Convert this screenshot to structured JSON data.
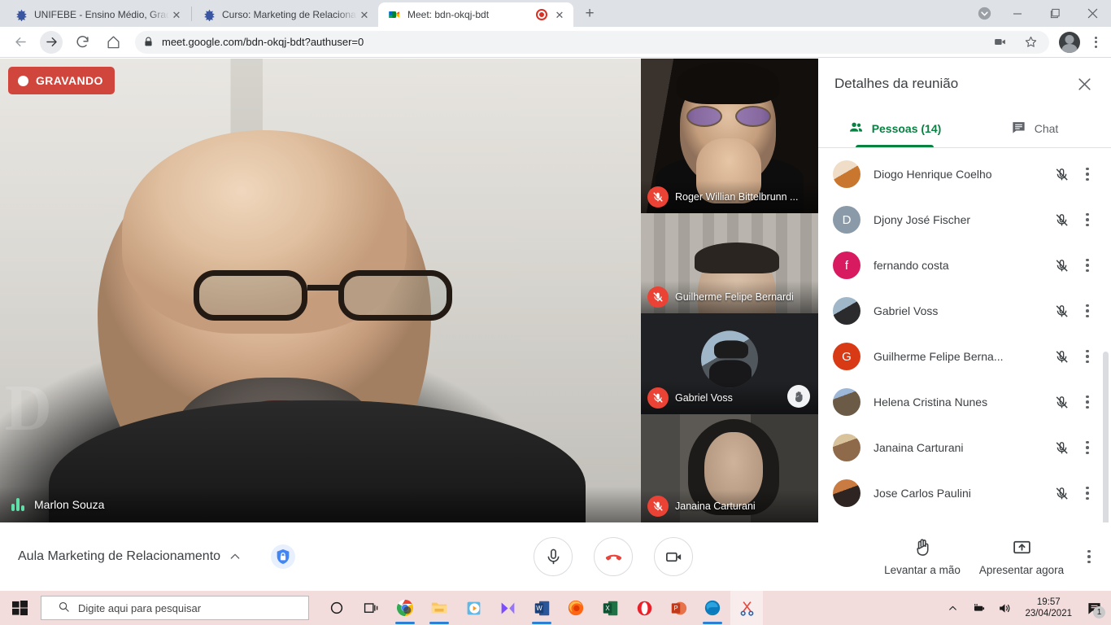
{
  "browser": {
    "tabs": [
      {
        "title": "UNIFEBE - Ensino Médio, Gradua",
        "favicon": "unifebe-icon",
        "active": false,
        "recording": false
      },
      {
        "title": "Curso: Marketing de Relacioname",
        "favicon": "unifebe-icon",
        "active": false,
        "recording": false
      },
      {
        "title": "Meet: bdn-okqj-bdt",
        "favicon": "google-meet-icon",
        "active": true,
        "recording": true
      }
    ],
    "new_tab_label": "+",
    "close_label": "✕",
    "url": "meet.google.com/bdn-okqj-bdt?authuser=0",
    "window_controls": {
      "minimize": "—",
      "maximize": "❐",
      "close": "✕"
    }
  },
  "meet": {
    "recording_badge": "GRAVANDO",
    "main_speaker": "Marlon Souza",
    "thumbnails": [
      {
        "name": "Roger Willian Bittelbrunn ...",
        "muted": true,
        "hand_raised": false
      },
      {
        "name": "Guilherme Felipe Bernardi",
        "muted": true,
        "hand_raised": false
      },
      {
        "name": "Gabriel Voss",
        "muted": true,
        "hand_raised": true
      },
      {
        "name": "Janaina Carturani",
        "muted": true,
        "hand_raised": false
      }
    ],
    "details": {
      "title": "Detalhes da reunião",
      "tabs": [
        {
          "label": "Pessoas (14)",
          "icon": "people-icon",
          "active": true
        },
        {
          "label": "Chat",
          "icon": "chat-icon",
          "active": false
        }
      ],
      "participants": [
        {
          "name": "Diogo Henrique Coelho",
          "avatar_type": "photo",
          "avatar_color": "#e8a87c",
          "initial": "",
          "muted": true
        },
        {
          "name": "Djony José Fischer",
          "avatar_type": "initial",
          "avatar_color": "#8a9aa8",
          "initial": "D",
          "muted": true
        },
        {
          "name": "fernando costa",
          "avatar_type": "initial",
          "avatar_color": "#d81b60",
          "initial": "f",
          "muted": true
        },
        {
          "name": "Gabriel Voss",
          "avatar_type": "photo",
          "avatar_color": "#6d7b86",
          "initial": "",
          "muted": true
        },
        {
          "name": "Guilherme Felipe Berna...",
          "avatar_type": "initial",
          "avatar_color": "#d93a16",
          "initial": "G",
          "muted": true
        },
        {
          "name": "Helena Cristina Nunes",
          "avatar_type": "photo",
          "avatar_color": "#8d7b63",
          "initial": "",
          "muted": true
        },
        {
          "name": "Janaina Carturani",
          "avatar_type": "photo",
          "avatar_color": "#b08d6a",
          "initial": "",
          "muted": true
        },
        {
          "name": "Jose Carlos Paulini",
          "avatar_type": "photo",
          "avatar_color": "#a85c3c",
          "initial": "",
          "muted": true
        }
      ]
    },
    "bottom_bar": {
      "meeting_title": "Aula Marketing de Relacionamento",
      "controls": [
        {
          "name": "microphone",
          "icon": "mic-icon"
        },
        {
          "name": "hangup",
          "icon": "phone-hangup-icon"
        },
        {
          "name": "camera",
          "icon": "video-icon"
        }
      ],
      "raise_hand_label": "Levantar a mão",
      "present_label": "Apresentar agora"
    }
  },
  "taskbar": {
    "search_placeholder": "Digite aqui para pesquisar",
    "apps": [
      "cortana-icon",
      "task-view-icon",
      "chrome-icon",
      "file-explorer-icon",
      "media-player-icon",
      "movies-tv-icon",
      "word-icon",
      "firefox-icon",
      "excel-icon",
      "opera-icon",
      "powerpoint-icon",
      "edge-icon",
      "snipping-tool-icon"
    ],
    "time": "19:57",
    "date": "23/04/2021",
    "notification_count": "1"
  },
  "colors": {
    "meet_green": "#0b8043",
    "recording_red": "#d0453c",
    "mute_red": "#ea4335",
    "chrome_tabstrip": "#dee1e6",
    "taskbar_bg": "#f3dcdc"
  }
}
